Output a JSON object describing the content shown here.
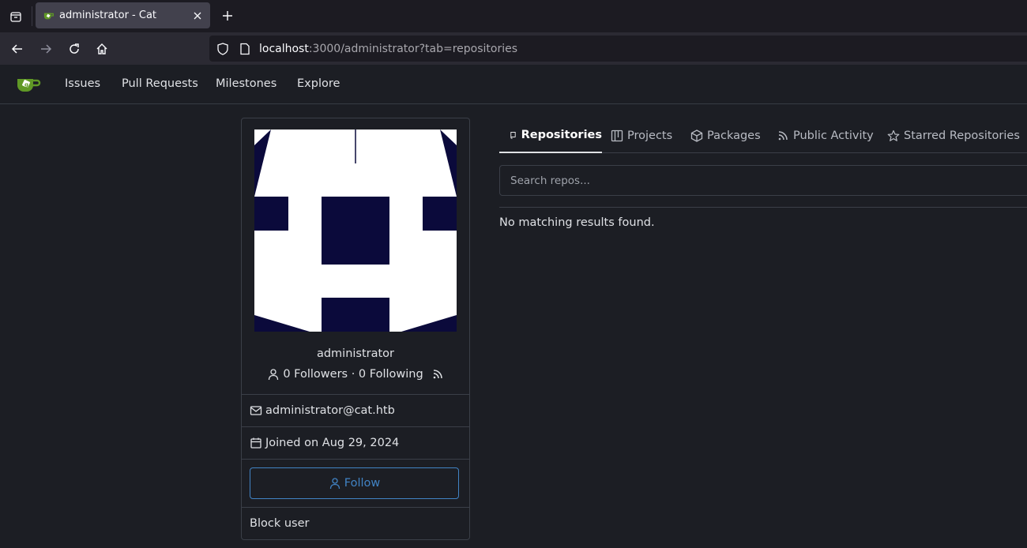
{
  "browser": {
    "tab_title": "administrator - Cat",
    "url_host": "localhost",
    "url_rest": ":3000/administrator?tab=repositories"
  },
  "nav": {
    "items": [
      "Issues",
      "Pull Requests",
      "Milestones",
      "Explore"
    ]
  },
  "profile": {
    "username": "administrator",
    "followers": "0 Followers · 0 Following",
    "email": "administrator@cat.htb",
    "joined": "Joined on Aug 29, 2024",
    "follow_label": "Follow",
    "block_label": "Block user"
  },
  "tabs": {
    "repositories": "Repositories",
    "projects": "Projects",
    "packages": "Packages",
    "activity": "Public Activity",
    "starred": "Starred Repositories"
  },
  "search": {
    "placeholder": "Search repos..."
  },
  "results": {
    "empty": "No matching results found."
  },
  "colors": {
    "accent": "#4183c4",
    "logo_green": "#609926",
    "avatar_dark": "#0b0a3b"
  }
}
